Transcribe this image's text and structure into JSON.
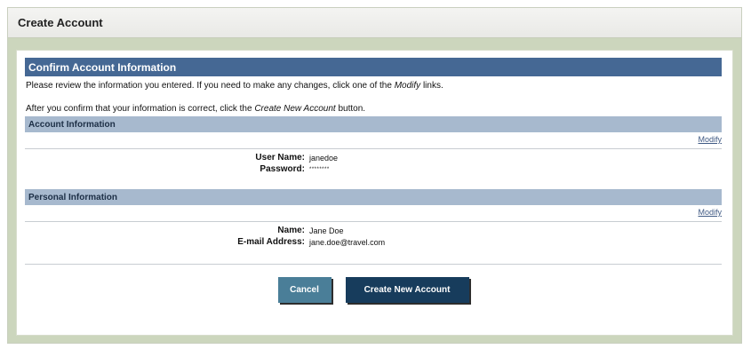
{
  "window": {
    "title": "Create Account"
  },
  "main": {
    "heading": "Confirm Account Information",
    "intro_line1": "Please review the information you entered. If you need to make any changes, click one of the",
    "intro_modify_word": "Modify",
    "intro_line1_end": "links.",
    "intro_line2_start": "After you confirm that your information is correct, click the",
    "intro_create_word": "Create New Account",
    "intro_line2_end": "button."
  },
  "account_section": {
    "title": "Account Information",
    "modify_label": "Modify",
    "fields": [
      {
        "label": "User Name:",
        "value": "janedoe"
      },
      {
        "label": "Password:",
        "value": "********"
      }
    ]
  },
  "personal_section": {
    "title": "Personal Information",
    "modify_label": "Modify",
    "fields": [
      {
        "label": "Name:",
        "value": "Jane Doe"
      },
      {
        "label": "E-mail Address:",
        "value": "jane.doe@travel.com"
      }
    ]
  },
  "actions": {
    "cancel_label": "Cancel",
    "create_label": "Create New Account"
  },
  "colors": {
    "heading_bar": "#456894",
    "section_bar": "#a7b9ce",
    "frame_bg": "#ccd6bd",
    "cancel_button": "#4a7e98",
    "create_button": "#173c5c",
    "link": "#405a84"
  }
}
